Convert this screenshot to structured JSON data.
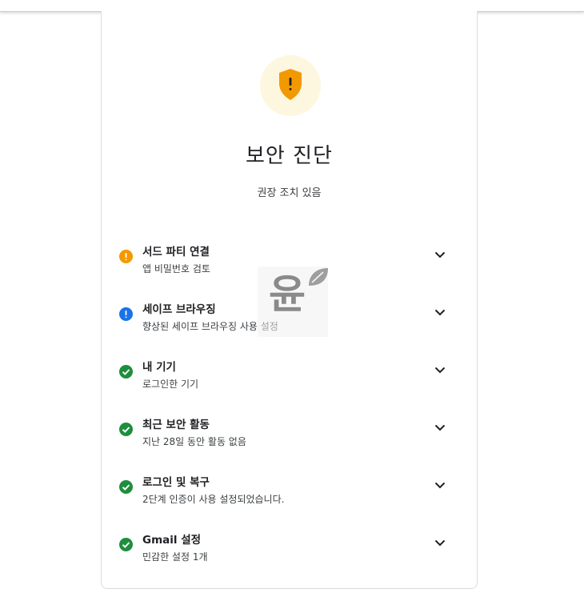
{
  "header": {
    "title": "보안 진단",
    "subtitle": "권장 조치 있음",
    "shield_icon": "shield-warning-icon",
    "shield_color": "#f29900",
    "shield_bg": "#fef7e0"
  },
  "items": [
    {
      "title": "서드 파티 연결",
      "desc": "앱 비밀번호 검토",
      "status": "warning",
      "icon": "warning-icon",
      "color": "#f29900"
    },
    {
      "title": "세이프 브라우징",
      "desc": "향상된 세이프 브라우징 사용 설정",
      "status": "info",
      "icon": "info-icon",
      "color": "#1a73e8"
    },
    {
      "title": "내 기기",
      "desc": "로그인한 기기",
      "status": "ok",
      "icon": "check-icon",
      "color": "#1e8e3e"
    },
    {
      "title": "최근 보안 활동",
      "desc": "지난 28일 동안 활동 없음",
      "status": "ok",
      "icon": "check-icon",
      "color": "#1e8e3e"
    },
    {
      "title": "로그인 및 복구",
      "desc": "2단계 인증이 사용 설정되었습니다.",
      "status": "ok",
      "icon": "check-icon",
      "color": "#1e8e3e"
    },
    {
      "title": "Gmail 설정",
      "desc": "민감한 설정 1개",
      "status": "ok",
      "icon": "check-icon",
      "color": "#1e8e3e"
    }
  ],
  "watermark": {
    "glyph": "윤"
  }
}
